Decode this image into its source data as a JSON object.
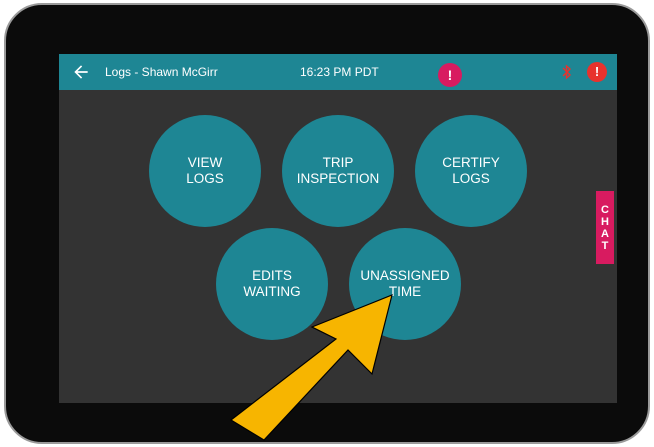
{
  "header": {
    "title": "Logs - Shawn McGirr",
    "time": "16:23 PM PDT",
    "back_icon": "back-arrow-icon",
    "bluetooth_icon": "bluetooth-icon",
    "alert_icon_text": "!",
    "bar_color": "#1e8694"
  },
  "buttons": {
    "view_logs": "VIEW\nLOGS",
    "trip_inspection": "TRIP\nINSPECTION",
    "certify_logs": "CERTIFY\nLOGS",
    "edits_waiting": "EDITS\nWAITING",
    "unassigned_time": "UNASSIGNED\nTIME"
  },
  "certify_badge": "!",
  "chat_tab": [
    "C",
    "H",
    "A",
    "T"
  ],
  "colors": {
    "accent": "#1e8694",
    "badge": "#d81b60",
    "alert": "#e8322d",
    "screen_bg": "#333333",
    "annotation_arrow": "#f7b500"
  }
}
